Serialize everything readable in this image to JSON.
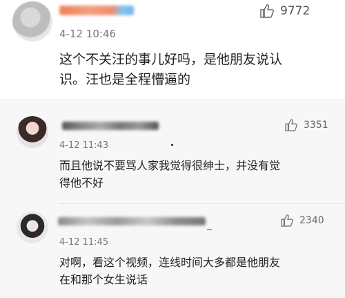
{
  "main_comment": {
    "time": "4-12 10:46",
    "likes": "9772",
    "text": "这个不关汪的事儿好吗，是他朋友说认\n识。汪也是全程懵逼的",
    "icon": "thumbs-up-icon"
  },
  "replies": [
    {
      "time": "4-12 11:43",
      "likes": "3351",
      "text": "而且他说不要骂人家我觉得很绅士，并没有觉\n得他不好",
      "icon": "thumbs-up-icon"
    },
    {
      "time": "4-12 11:45",
      "likes": "2340",
      "username_suffix": "_",
      "text": "对啊，看这个视频，连线时间大多都是他朋友\n在和那个女生说话",
      "icon": "thumbs-up-icon"
    }
  ],
  "colors": {
    "reply_background": "#f7f7f7",
    "main_background": "#ffffff",
    "text": "#222222",
    "meta": "#777777"
  }
}
